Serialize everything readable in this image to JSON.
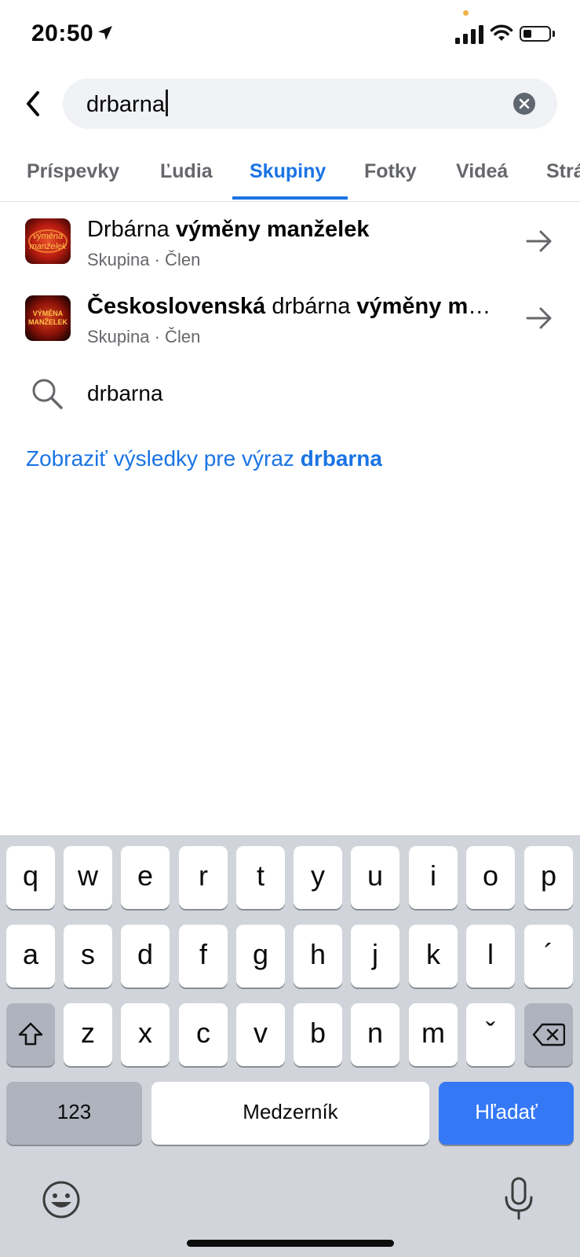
{
  "status_bar": {
    "time": "20:50"
  },
  "search": {
    "query": "drbarna"
  },
  "tabs": [
    {
      "label": "Príspevky",
      "active": false
    },
    {
      "label": "Ľudia",
      "active": false
    },
    {
      "label": "Skupiny",
      "active": true
    },
    {
      "label": "Fotky",
      "active": false
    },
    {
      "label": "Videá",
      "active": false
    },
    {
      "label": "Stránky",
      "active": false
    }
  ],
  "results": [
    {
      "title_parts": [
        {
          "text": "Drbárna ",
          "bold": false
        },
        {
          "text": "výměny manželek",
          "bold": true
        }
      ],
      "subtitle": "Skupina · Člen",
      "thumb_text": "výměna manželek"
    },
    {
      "title_parts": [
        {
          "text": "Československá",
          "bold": true
        },
        {
          "text": " drbárna ",
          "bold": false
        },
        {
          "text": "výměny manželek",
          "bold": true
        }
      ],
      "subtitle": "Skupina · Člen",
      "thumb_text": "VÝMĚNA MANŽELEK"
    }
  ],
  "suggestion": {
    "text": "drbarna"
  },
  "see_all": {
    "prefix": "Zobraziť výsledky pre výraz ",
    "query": "drbarna"
  },
  "keyboard": {
    "row1": [
      "q",
      "w",
      "e",
      "r",
      "t",
      "y",
      "u",
      "i",
      "o",
      "p"
    ],
    "row2": [
      "a",
      "s",
      "d",
      "f",
      "g",
      "h",
      "j",
      "k",
      "l",
      "´"
    ],
    "row3": [
      "z",
      "x",
      "c",
      "v",
      "b",
      "n",
      "m",
      "ˇ"
    ],
    "numbers_label": "123",
    "space_label": "Medzerník",
    "search_label": "Hľadať"
  },
  "colors": {
    "accent": "#1b74e4",
    "keyboard_bg": "#d1d4da",
    "search_key": "#3478f6"
  }
}
